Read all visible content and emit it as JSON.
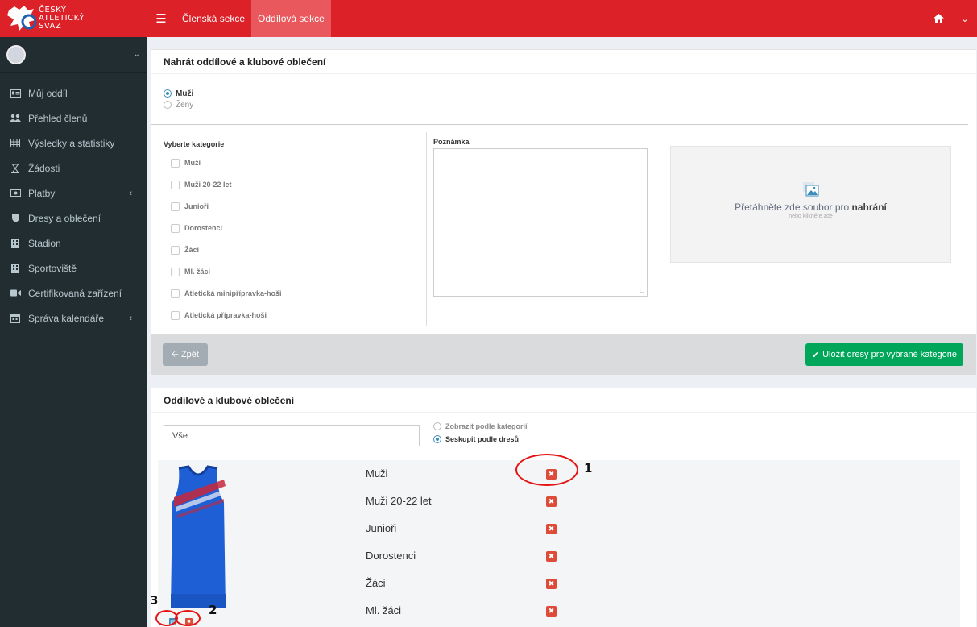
{
  "brand": {
    "line1": "ČESKÝ",
    "line2": "ATLETICKÝ",
    "line3": "SVAZ"
  },
  "topbar": {
    "tabs": [
      {
        "label": "Členská sekce",
        "active": false
      },
      {
        "label": "Oddílová sekce",
        "active": true
      }
    ],
    "menu_icon": "hamburger-icon",
    "home_icon": "home-icon"
  },
  "sidebar": {
    "items": [
      {
        "label": "Můj oddíl",
        "icon": "id-card-icon"
      },
      {
        "label": "Přehled členů",
        "icon": "users-icon"
      },
      {
        "label": "Výsledky a statistiky",
        "icon": "table-icon"
      },
      {
        "label": "Žádosti",
        "icon": "hourglass-icon"
      },
      {
        "label": "Platby",
        "icon": "money-icon",
        "has_submenu": true
      },
      {
        "label": "Dresy a oblečení",
        "icon": "shield-icon"
      },
      {
        "label": "Stadion",
        "icon": "building-icon"
      },
      {
        "label": "Sportoviště",
        "icon": "building-icon"
      },
      {
        "label": "Certifikovaná zařízení",
        "icon": "video-camera-icon"
      },
      {
        "label": "Správa kalendáře",
        "icon": "calendar-icon",
        "has_submenu": true
      }
    ]
  },
  "upload": {
    "title": "Nahrát oddílové a klubové oblečení",
    "gender": [
      {
        "label": "Muži",
        "selected": true
      },
      {
        "label": "Ženy",
        "selected": false
      }
    ],
    "categories_label": "Vyberte kategorie",
    "categories": [
      "Muži",
      "Muži 20-22 let",
      "Junioři",
      "Dorostenci",
      "Žáci",
      "Ml. žáci",
      "Atletická minipřípravka-hoši",
      "Atletická přípravka-hoši"
    ],
    "note_label": "Poznámka",
    "dropzone_text": "Přetáhněte zde soubor pro",
    "dropzone_bold": "nahrání",
    "dropzone_sub": "nebo klikněte zde",
    "back_label": "Zpět",
    "save_label": "Uložit dresy pro vybrané kategorie"
  },
  "clothing": {
    "title": "Oddílové a klubové oblečení",
    "search_value": "Vše",
    "view_options": [
      {
        "label": "Zobrazit podle kategorií",
        "selected": false
      },
      {
        "label": "Seskupit podle dresů",
        "selected": true
      }
    ],
    "assigned_categories": [
      "Muži",
      "Muži 20-22 let",
      "Junioři",
      "Dorostenci",
      "Žáci",
      "Ml. žáci"
    ]
  },
  "annotations": [
    "1",
    "2",
    "3"
  ],
  "colors": {
    "brand_red": "#dd2128",
    "sidebar": "#222d32",
    "success": "#00a65a",
    "danger": "#dd4b39",
    "primary": "#3c8dbc"
  }
}
